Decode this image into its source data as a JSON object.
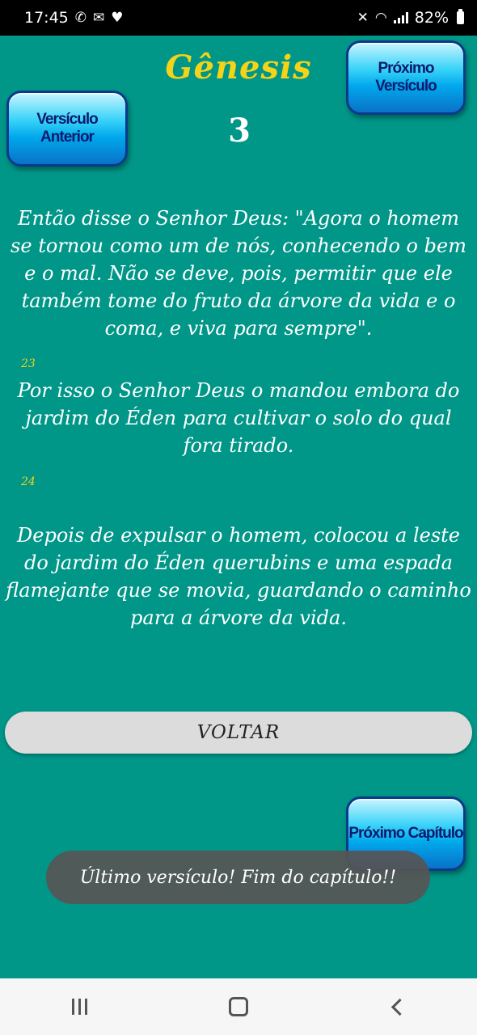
{
  "status_bar": {
    "time": "17:45",
    "battery": "82%",
    "left_icons": [
      "whatsapp-icon",
      "chat-icon",
      "heart-icon"
    ],
    "right_icons": [
      "mute-icon",
      "wifi-icon",
      "signal-icon",
      "battery-icon"
    ]
  },
  "header": {
    "book": "Gênesis",
    "chapter": "3"
  },
  "buttons": {
    "next_verse": "Próximo Versículo",
    "prev_verse": "Versículo Anterior",
    "back": "VOLTAR",
    "next_chapter": "Próximo Capítulo"
  },
  "verses": [
    {
      "number": "",
      "text": "Então disse o Senhor Deus: \"Agora o homem se tornou como um de nós, conhecendo o bem e o mal. Não se deve, pois, permitir que ele também tome do fruto da árvore da vida e o coma, e viva para sempre\"."
    },
    {
      "number": "23",
      "text": "Por isso o Senhor Deus o mandou embora do jardim do Éden para cultivar o solo do qual fora tirado."
    },
    {
      "number": "24",
      "text": "Depois de expulsar o homem, colocou a leste do jardim do Éden querubins e uma espada flamejante que se movia, guardando o caminho para a árvore da vida."
    }
  ],
  "toast": "Último versículo! Fim do capítulo!!",
  "colors": {
    "background": "#009688",
    "title": "#f4d318",
    "button_blue": "#00a8ec",
    "button_text": "#0c1a6e"
  },
  "nav_bar": {
    "icons": [
      "recent-apps-icon",
      "home-icon",
      "back-icon"
    ]
  }
}
